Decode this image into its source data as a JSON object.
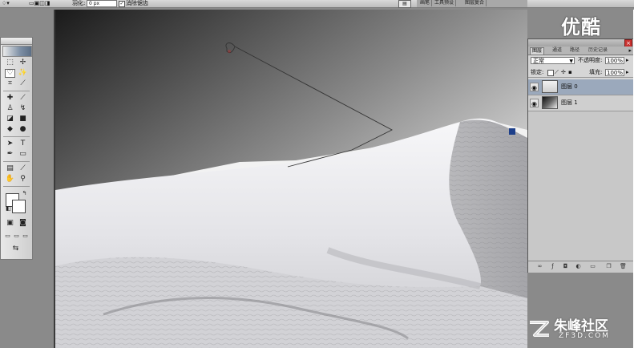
{
  "options_bar": {
    "feather_label": "羽化:",
    "feather_value": "0 px",
    "antialias_label": "消除锯齿",
    "antialias_checked": true,
    "workspace_tabs": [
      "画笔",
      "工具预设",
      "图层复合"
    ]
  },
  "toolbox": {
    "foreground_color": "#ffffff",
    "background_color": "#ffffff"
  },
  "layers_panel": {
    "tabs": [
      "图层",
      "通道",
      "路径",
      "历史记录"
    ],
    "active_tab": "图层",
    "blend_mode": "正常",
    "opacity_label": "不透明度:",
    "opacity_value": "100%",
    "lock_label": "锁定:",
    "fill_label": "填充:",
    "fill_value": "100%",
    "layers": [
      {
        "name": "图层 0",
        "visible": true,
        "selected": true
      },
      {
        "name": "图层 1",
        "visible": true,
        "selected": false
      }
    ]
  },
  "watermarks": {
    "top_right": "优酷",
    "bottom_right_cn": "朱峰社区",
    "bottom_right_en": "ZF3D.COM"
  },
  "colors": {
    "ui_gray": "#d6d6d6",
    "selected_layer": "#9ba9bc",
    "close_red": "#c9312f"
  }
}
